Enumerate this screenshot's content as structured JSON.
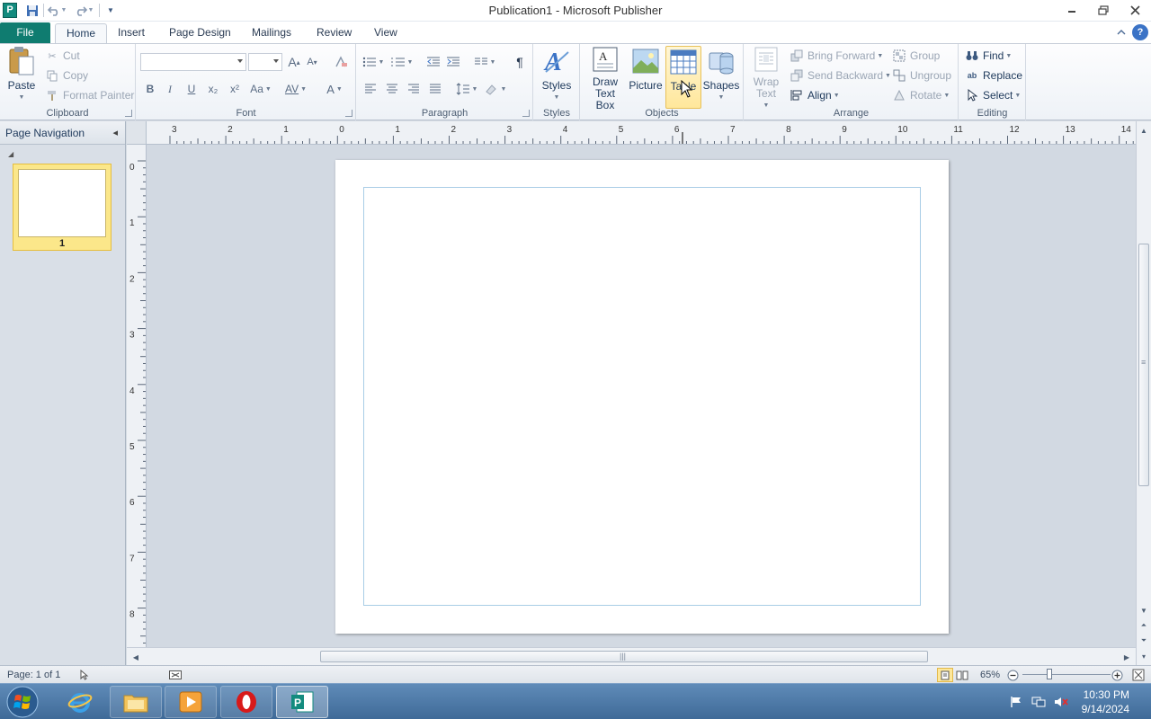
{
  "window": {
    "title": "Publication1  -  Microsoft Publisher",
    "app_icon_letter": "P"
  },
  "tabs": {
    "file": "File",
    "home": "Home",
    "insert": "Insert",
    "page_design": "Page Design",
    "mailings": "Mailings",
    "review": "Review",
    "view": "View"
  },
  "ribbon": {
    "clipboard": {
      "label": "Clipboard",
      "paste": "Paste",
      "cut": "Cut",
      "copy": "Copy",
      "format_painter": "Format Painter"
    },
    "font": {
      "label": "Font",
      "bold": "B",
      "italic": "I",
      "underline": "U",
      "subscript": "x₂",
      "superscript": "x²",
      "change_case": "Aa",
      "char_spacing": "AV",
      "font_color": "A",
      "grow": "A",
      "shrink": "A"
    },
    "paragraph": {
      "label": "Paragraph",
      "pilcrow": "¶"
    },
    "styles": {
      "label": "Styles",
      "styles_button": "Styles"
    },
    "objects": {
      "label": "Objects",
      "draw_text_box_1": "Draw",
      "draw_text_box_2": "Text Box",
      "picture": "Picture",
      "table": "Table",
      "shapes": "Shapes"
    },
    "arrange": {
      "label": "Arrange",
      "wrap_text_1": "Wrap",
      "wrap_text_2": "Text",
      "bring_forward": "Bring Forward",
      "send_backward": "Send Backward",
      "align": "Align",
      "group": "Group",
      "ungroup": "Ungroup",
      "rotate": "Rotate"
    },
    "editing": {
      "label": "Editing",
      "find": "Find",
      "replace": "Replace",
      "select": "Select"
    }
  },
  "nav_pane": {
    "title": "Page Navigation",
    "pages": [
      {
        "number": "1"
      }
    ]
  },
  "rulers": {
    "horizontal": [
      "3",
      "2",
      "1",
      "0",
      "1",
      "2",
      "3",
      "4",
      "5",
      "6",
      "7",
      "8",
      "9",
      "10",
      "11",
      "12",
      "13",
      "14"
    ],
    "vertical": [
      "0",
      "1",
      "2",
      "3",
      "4",
      "5",
      "6",
      "7",
      "8"
    ]
  },
  "status": {
    "page": "Page: 1 of 1",
    "zoom": "65%"
  },
  "taskbar": {
    "time": "10:30 PM",
    "date": "9/14/2024"
  },
  "colors": {
    "accent": "#0f7c70",
    "hover": "#ffe79b",
    "guide": "#a9cde6"
  }
}
